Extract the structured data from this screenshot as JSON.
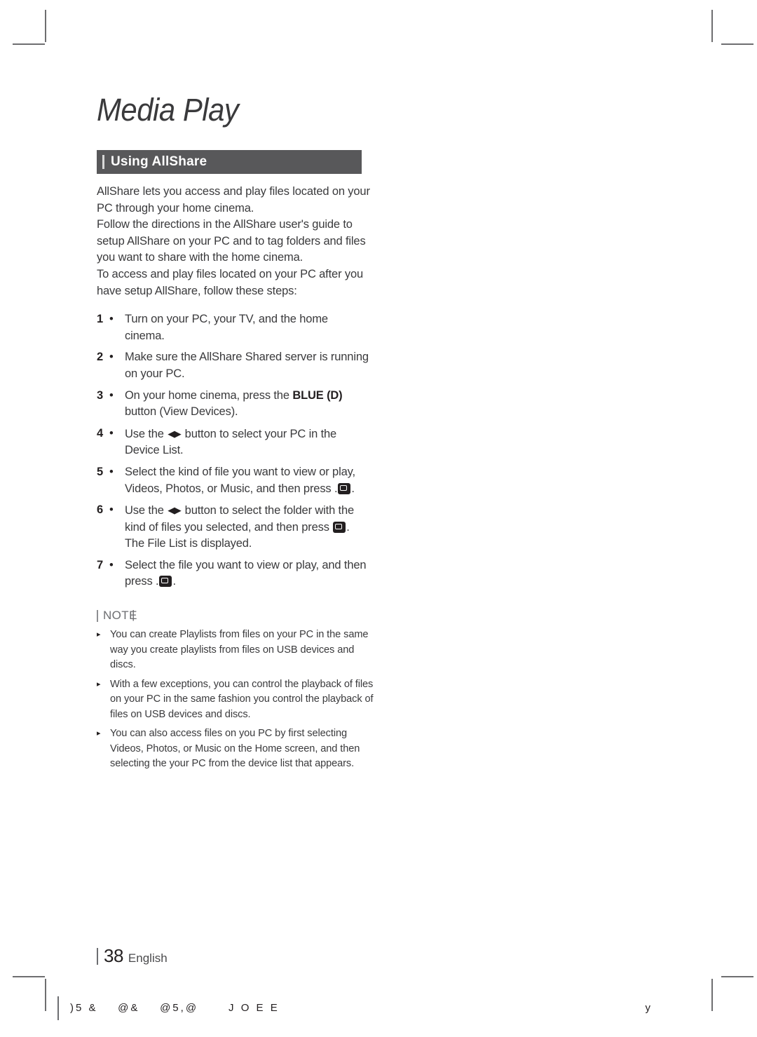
{
  "document": {
    "chapter_title": "Media Play",
    "section_title": "Using AllShare",
    "page_number": "38",
    "language": "English"
  },
  "intro": {
    "paragraph_1": "AllShare lets you access and play files located on your PC through your home cinema.",
    "paragraph_2": "Follow the directions in the AllShare user's guide to setup AllShare on your PC and to tag folders and files you want to share with the home cinema.",
    "paragraph_3": "To access and play files located on your PC after you have setup AllShare, follow these steps:"
  },
  "steps": [
    {
      "number": "1",
      "separator": "•",
      "text_before": "Turn on your PC, your TV, and the home cinema.",
      "bold": "",
      "text_after": "",
      "has_arrows": false,
      "trailing_enter": false
    },
    {
      "number": "2",
      "separator": "•",
      "text_before": "Make sure the AllShare Shared server is running on your PC.",
      "bold": "",
      "text_after": "",
      "has_arrows": false,
      "trailing_enter": false
    },
    {
      "number": "3",
      "separator": "•",
      "text_before": "On your home cinema, press the ",
      "bold": "BLUE (D)",
      "text_after": " button (View Devices).",
      "has_arrows": false,
      "trailing_enter": false
    },
    {
      "number": "4",
      "separator": "•",
      "text_before": "Use the ",
      "bold": "",
      "text_after": " button to select your PC in the Device List.",
      "has_arrows": true,
      "trailing_enter": false
    },
    {
      "number": "5",
      "separator": "•",
      "text_before": "Select the kind of file you want to view or play, Videos, Photos, or Music, and then press ",
      "bold": "",
      "text_after": ".",
      "has_arrows": false,
      "trailing_enter": true
    },
    {
      "number": "6",
      "separator": "•",
      "text_before": "Use the ",
      "bold": "",
      "text_after": " button to select the folder with the kind of files you selected, and then press ",
      "has_arrows": true,
      "trailing_enter": true,
      "text_tail": ". The File List is displayed."
    },
    {
      "number": "7",
      "separator": "•",
      "text_before": "Select the file you want to view or play, and then press ",
      "bold": "",
      "text_after": ".",
      "has_arrows": false,
      "trailing_enter": true
    }
  ],
  "note": {
    "heading": "NOTE",
    "bullet_glyph": "▸",
    "items": [
      "You can create Playlists from files on your PC in the same way you create playlists from files on USB devices and discs.",
      "With a few exceptions, you can control the playback of files on your PC in the same fashion you control the playback of files on USB devices and discs.",
      "You can also access files on you PC by first selecting Videos, Photos, or Music on the Home screen, and then selecting the your PC from the device list that appears."
    ]
  },
  "print_marks": {
    "code": ")5 &    @&    @5,@      J O E E",
    "right_mark": "y"
  },
  "arrow_glyphs": "◀▶",
  "colors": {
    "section_bar": "#58585a",
    "body_text": "#3a3a3c",
    "heading_text": "#231f20",
    "note_text": "#3a3a3c"
  }
}
